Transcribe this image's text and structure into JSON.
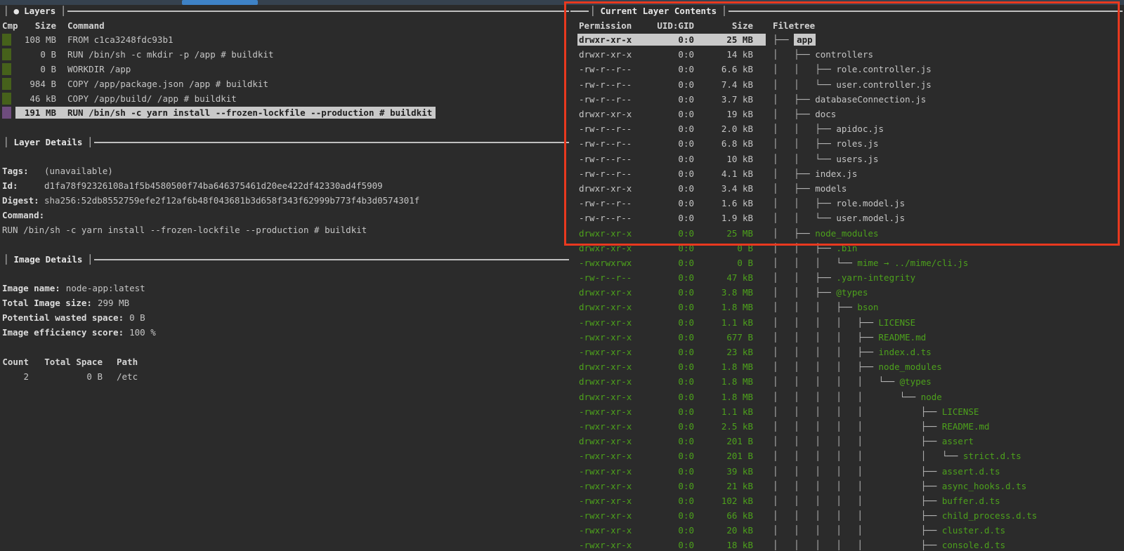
{
  "glyphs": {
    "pipe": "│",
    "dot": "●"
  },
  "colors": {
    "background": "#2b2b2b",
    "text": "#c6c6c6",
    "green_file_text": "#4da11c",
    "green_layer_block": "#46611b",
    "purple_layer_block": "#6e4c7d",
    "selection_bg": "#c9c9c9",
    "selection_text": "#1e1e1e",
    "annotation_red": "#e8391f",
    "scroll_track": "#36424f",
    "scroll_thumb": "#3e82c6"
  },
  "left": {
    "layers": {
      "title": "Layers",
      "columns": {
        "cmp": "Cmp",
        "size": "Size",
        "command": "Command"
      },
      "rows": [
        {
          "block": "green",
          "size": "108 MB",
          "command": "FROM c1ca3248fdc93b1",
          "selected": false
        },
        {
          "block": "green",
          "size": "0 B",
          "command": "RUN /bin/sh -c mkdir -p /app # buildkit",
          "selected": false
        },
        {
          "block": "green",
          "size": "0 B",
          "command": "WORKDIR /app",
          "selected": false
        },
        {
          "block": "green",
          "size": "984 B",
          "command": "COPY /app/package.json /app # buildkit",
          "selected": false
        },
        {
          "block": "green",
          "size": "46 kB",
          "command": "COPY /app/build/ /app # buildkit",
          "selected": false
        },
        {
          "block": "purple",
          "size": "191 MB",
          "command": "RUN /bin/sh -c yarn install --frozen-lockfile --production # buildkit",
          "selected": true
        }
      ]
    },
    "layer_details": {
      "title": "Layer Details",
      "fields": [
        {
          "label": "Tags:",
          "value": "(unavailable)"
        },
        {
          "label": "Id:",
          "value": "d1fa78f92326108a1f5b4580500f74ba646375461d20ee422df42330ad4f5909"
        },
        {
          "label": "Digest:",
          "value": "sha256:52db8552759efe2f12af6b48f043681b3d658f343f62999b773f4b3d0574301f"
        },
        {
          "label": "Command:",
          "value": ""
        }
      ],
      "command_text": "RUN /bin/sh -c yarn install --frozen-lockfile --production # buildkit"
    },
    "image_details": {
      "title": "Image Details",
      "lines": [
        {
          "label": "Image name:",
          "value": "node-app:latest"
        },
        {
          "label": "Total Image size:",
          "value": "299 MB"
        },
        {
          "label": "Potential wasted space:",
          "value": "0 B"
        },
        {
          "label": "Image efficiency score:",
          "value": "100 %"
        }
      ],
      "table": {
        "headers": [
          "Count",
          "Total Space",
          "Path"
        ],
        "rows": [
          {
            "count": "2",
            "total_space": "0 B",
            "path": "/etc"
          }
        ]
      }
    }
  },
  "right": {
    "title": "Current Layer Contents",
    "columns": {
      "permission": "Permission",
      "uid_gid": "UID:GID",
      "size": "Size",
      "filetree": "Filetree"
    },
    "rows": [
      {
        "perm": "drwxr-xr-x",
        "uid": "0:0",
        "size": "25 MB",
        "prefix": "├── ",
        "name": "app",
        "green": false,
        "selected": true
      },
      {
        "perm": "drwxr-xr-x",
        "uid": "0:0",
        "size": "14 kB",
        "prefix": "│   ├── ",
        "name": "controllers",
        "green": false,
        "selected": false
      },
      {
        "perm": "-rw-r--r--",
        "uid": "0:0",
        "size": "6.6 kB",
        "prefix": "│   │   ├── ",
        "name": "role.controller.js",
        "green": false,
        "selected": false
      },
      {
        "perm": "-rw-r--r--",
        "uid": "0:0",
        "size": "7.4 kB",
        "prefix": "│   │   └── ",
        "name": "user.controller.js",
        "green": false,
        "selected": false
      },
      {
        "perm": "-rw-r--r--",
        "uid": "0:0",
        "size": "3.7 kB",
        "prefix": "│   ├── ",
        "name": "databaseConnection.js",
        "green": false,
        "selected": false
      },
      {
        "perm": "drwxr-xr-x",
        "uid": "0:0",
        "size": "19 kB",
        "prefix": "│   ├── ",
        "name": "docs",
        "green": false,
        "selected": false
      },
      {
        "perm": "-rw-r--r--",
        "uid": "0:0",
        "size": "2.0 kB",
        "prefix": "│   │   ├── ",
        "name": "apidoc.js",
        "green": false,
        "selected": false
      },
      {
        "perm": "-rw-r--r--",
        "uid": "0:0",
        "size": "6.8 kB",
        "prefix": "│   │   ├── ",
        "name": "roles.js",
        "green": false,
        "selected": false
      },
      {
        "perm": "-rw-r--r--",
        "uid": "0:0",
        "size": "10 kB",
        "prefix": "│   │   └── ",
        "name": "users.js",
        "green": false,
        "selected": false
      },
      {
        "perm": "-rw-r--r--",
        "uid": "0:0",
        "size": "4.1 kB",
        "prefix": "│   ├── ",
        "name": "index.js",
        "green": false,
        "selected": false
      },
      {
        "perm": "drwxr-xr-x",
        "uid": "0:0",
        "size": "3.4 kB",
        "prefix": "│   ├── ",
        "name": "models",
        "green": false,
        "selected": false
      },
      {
        "perm": "-rw-r--r--",
        "uid": "0:0",
        "size": "1.6 kB",
        "prefix": "│   │   ├── ",
        "name": "role.model.js",
        "green": false,
        "selected": false
      },
      {
        "perm": "-rw-r--r--",
        "uid": "0:0",
        "size": "1.9 kB",
        "prefix": "│   │   └── ",
        "name": "user.model.js",
        "green": false,
        "selected": false
      },
      {
        "perm": "drwxr-xr-x",
        "uid": "0:0",
        "size": "25 MB",
        "prefix": "│   ├── ",
        "name": "node_modules",
        "green": true,
        "selected": false
      },
      {
        "perm": "drwxr-xr-x",
        "uid": "0:0",
        "size": "0 B",
        "prefix": "│   │   ├── ",
        "name": ".bin",
        "green": true,
        "selected": false
      },
      {
        "perm": "-rwxrwxrwx",
        "uid": "0:0",
        "size": "0 B",
        "prefix": "│   │   │   └── ",
        "name": "mime → ../mime/cli.js",
        "green": true,
        "selected": false
      },
      {
        "perm": "-rw-r--r--",
        "uid": "0:0",
        "size": "47 kB",
        "prefix": "│   │   ├── ",
        "name": ".yarn-integrity",
        "green": true,
        "selected": false
      },
      {
        "perm": "drwxr-xr-x",
        "uid": "0:0",
        "size": "3.8 MB",
        "prefix": "│   │   ├── ",
        "name": "@types",
        "green": true,
        "selected": false
      },
      {
        "perm": "drwxr-xr-x",
        "uid": "0:0",
        "size": "1.8 MB",
        "prefix": "│   │   │   ├── ",
        "name": "bson",
        "green": true,
        "selected": false
      },
      {
        "perm": "-rwxr-xr-x",
        "uid": "0:0",
        "size": "1.1 kB",
        "prefix": "│   │   │   │   ├── ",
        "name": "LICENSE",
        "green": true,
        "selected": false
      },
      {
        "perm": "-rwxr-xr-x",
        "uid": "0:0",
        "size": "677 B",
        "prefix": "│   │   │   │   ├── ",
        "name": "README.md",
        "green": true,
        "selected": false
      },
      {
        "perm": "-rwxr-xr-x",
        "uid": "0:0",
        "size": "23 kB",
        "prefix": "│   │   │   │   ├── ",
        "name": "index.d.ts",
        "green": true,
        "selected": false
      },
      {
        "perm": "drwxr-xr-x",
        "uid": "0:0",
        "size": "1.8 MB",
        "prefix": "│   │   │   │   ├── ",
        "name": "node_modules",
        "green": true,
        "selected": false
      },
      {
        "perm": "drwxr-xr-x",
        "uid": "0:0",
        "size": "1.8 MB",
        "prefix": "│   │   │   │   │   └── ",
        "name": "@types",
        "green": true,
        "selected": false
      },
      {
        "perm": "drwxr-xr-x",
        "uid": "0:0",
        "size": "1.8 MB",
        "prefix": "│   │   │   │   │       └── ",
        "name": "node",
        "green": true,
        "selected": false
      },
      {
        "perm": "-rwxr-xr-x",
        "uid": "0:0",
        "size": "1.1 kB",
        "prefix": "│   │   │   │   │           ├── ",
        "name": "LICENSE",
        "green": true,
        "selected": false
      },
      {
        "perm": "-rwxr-xr-x",
        "uid": "0:0",
        "size": "2.5 kB",
        "prefix": "│   │   │   │   │           ├── ",
        "name": "README.md",
        "green": true,
        "selected": false
      },
      {
        "perm": "drwxr-xr-x",
        "uid": "0:0",
        "size": "201 B",
        "prefix": "│   │   │   │   │           ├── ",
        "name": "assert",
        "green": true,
        "selected": false
      },
      {
        "perm": "-rwxr-xr-x",
        "uid": "0:0",
        "size": "201 B",
        "prefix": "│   │   │   │   │           │   └── ",
        "name": "strict.d.ts",
        "green": true,
        "selected": false
      },
      {
        "perm": "-rwxr-xr-x",
        "uid": "0:0",
        "size": "39 kB",
        "prefix": "│   │   │   │   │           ├── ",
        "name": "assert.d.ts",
        "green": true,
        "selected": false
      },
      {
        "perm": "-rwxr-xr-x",
        "uid": "0:0",
        "size": "21 kB",
        "prefix": "│   │   │   │   │           ├── ",
        "name": "async_hooks.d.ts",
        "green": true,
        "selected": false
      },
      {
        "perm": "-rwxr-xr-x",
        "uid": "0:0",
        "size": "102 kB",
        "prefix": "│   │   │   │   │           ├── ",
        "name": "buffer.d.ts",
        "green": true,
        "selected": false
      },
      {
        "perm": "-rwxr-xr-x",
        "uid": "0:0",
        "size": "66 kB",
        "prefix": "│   │   │   │   │           ├── ",
        "name": "child_process.d.ts",
        "green": true,
        "selected": false
      },
      {
        "perm": "-rwxr-xr-x",
        "uid": "0:0",
        "size": "20 kB",
        "prefix": "│   │   │   │   │           ├── ",
        "name": "cluster.d.ts",
        "green": true,
        "selected": false
      },
      {
        "perm": "-rwxr-xr-x",
        "uid": "0:0",
        "size": "18 kB",
        "prefix": "│   │   │   │   │           ├── ",
        "name": "console.d.ts",
        "green": true,
        "selected": false
      }
    ]
  }
}
